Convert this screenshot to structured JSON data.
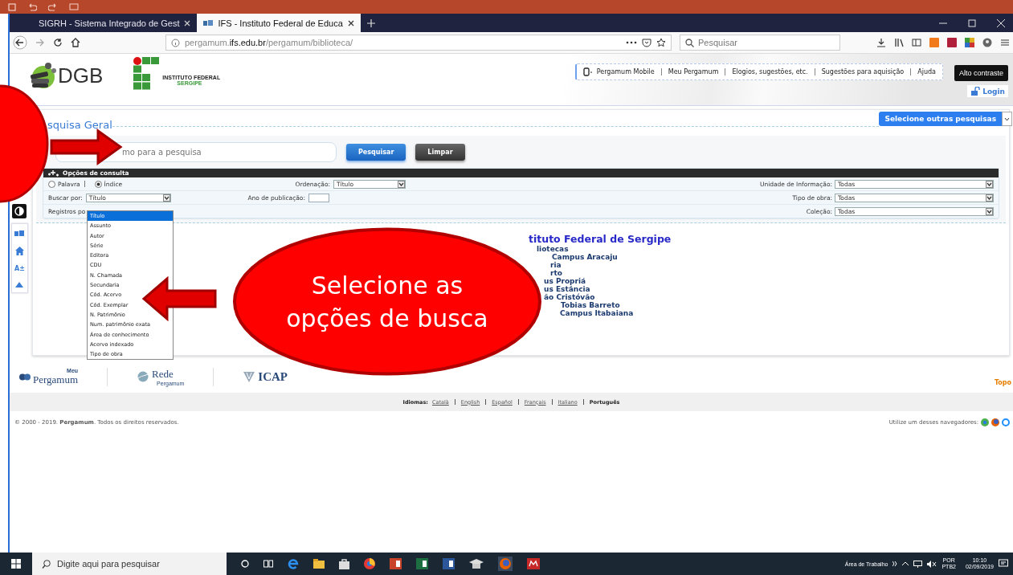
{
  "browser": {
    "tabs": [
      {
        "label": "SIGRH - Sistema Integrado de Gest",
        "selected": false
      },
      {
        "label": "IFS - Instituto Federal de Educa",
        "selected": true
      }
    ],
    "url_parts": [
      {
        "text": "pergamum.",
        "strong": false
      },
      {
        "text": "ifs.edu.br",
        "strong": true
      },
      {
        "text": "/pergamum/biblioteca/",
        "strong": false
      }
    ],
    "search_placeholder": "Pesquisar"
  },
  "header": {
    "logo_text": "DGB",
    "institute_name": "INSTITUTO FEDERAL",
    "institute_state": "SERGIPE",
    "links": [
      "Pergamum Mobile",
      "Meu Pergamum",
      "Elogios, sugestões, etc.",
      "Sugestões para aquisição",
      "Ajuda"
    ],
    "contrast_button": "Alto contraste",
    "login": "Login"
  },
  "search": {
    "title": "squisa Geral",
    "other_searches": "Selecione outras pesquisas",
    "placeholder": "mo para a pesquisa",
    "buttons": [
      {
        "label": "Pesquisar",
        "kind": "primary"
      },
      {
        "label": "Limpar",
        "kind": "secondary"
      }
    ]
  },
  "options": {
    "title": "Opções de consulta",
    "radios": [
      {
        "label": "Palavra",
        "selected": false
      },
      {
        "label": "Índice",
        "selected": true
      }
    ],
    "order_label": "Ordenação:",
    "order_value": "Título",
    "search_by_label": "Buscar por:",
    "search_by_value": "Título",
    "year_label": "Ano de publicação:",
    "records_label": "Registros po",
    "filters": [
      {
        "label": "Unidade de Informação:",
        "value": "Todas"
      },
      {
        "label": "Tipo de obra:",
        "value": "Todas"
      },
      {
        "label": "Coleção:",
        "value": "Todas"
      }
    ],
    "dropdown": [
      {
        "label": "Título",
        "selected": true
      },
      {
        "label": "Assunto",
        "selected": false
      },
      {
        "label": "Autor",
        "selected": false
      },
      {
        "label": "Série",
        "selected": false
      },
      {
        "label": "Editora",
        "selected": false
      },
      {
        "label": "CDU",
        "selected": false
      },
      {
        "label": "N. Chamada",
        "selected": false
      },
      {
        "label": "Secundaria",
        "selected": false
      },
      {
        "label": "Cód. Acervo",
        "selected": false
      },
      {
        "label": "Cód. Exemplar",
        "selected": false
      },
      {
        "label": "N. Patrimônio",
        "selected": false
      },
      {
        "label": "Num. patrimônio exata",
        "selected": false
      },
      {
        "label": "Área de conhecimento",
        "selected": false
      },
      {
        "label": "Acervo indexado",
        "selected": false
      },
      {
        "label": "Tipo de obra",
        "selected": false
      }
    ]
  },
  "sidebar": {
    "font_tool": "A±"
  },
  "library": {
    "title": "tituto Federal de Sergipe",
    "items": [
      "liotecas",
      "Campus Aracaju",
      "ria",
      "rto",
      "us Propriá",
      "us Estância",
      "ão Cristóvão",
      "Tobias Barreto",
      "Campus Itabaiana"
    ]
  },
  "footer": {
    "logos": [
      {
        "kind": "meu",
        "small": "Meu",
        "big": "Pergamum"
      },
      {
        "kind": "rede",
        "small": "Pergamum",
        "big": "Rede"
      },
      {
        "kind": "icap",
        "big": "ICAP"
      }
    ],
    "top_link": "Topo",
    "languages_label": "Idiomas:",
    "languages": [
      {
        "label": "Català",
        "selected": false
      },
      {
        "label": "English",
        "selected": false
      },
      {
        "label": "Español",
        "selected": false
      },
      {
        "label": "Français",
        "selected": false
      },
      {
        "label": "Italiano",
        "selected": false
      },
      {
        "label": "Português",
        "selected": true
      }
    ],
    "copyright": "© 2000 - 2019. **Pergamum**. Todos os direitos reservados.",
    "browsers_note": "Utilize um desses navegadores:"
  },
  "taskbar": {
    "search_placeholder": "Digite aqui para pesquisar",
    "desktop_label": "Área de Trabalho",
    "language": "POR",
    "layout": "PTB2",
    "time": "10:10",
    "date": "02/09/2019"
  },
  "annotation": {
    "text": "Selecione as opções de busca"
  }
}
